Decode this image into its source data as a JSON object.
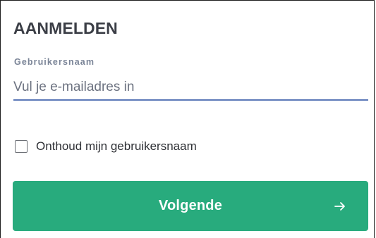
{
  "login": {
    "title": "AANMELDEN",
    "username_label": "Gebruikersnaam",
    "username_value": "",
    "username_placeholder": "Vul je e-mailadres in",
    "remember_label": "Onthoud mijn gebruikersnaam",
    "remember_checked": false,
    "next_label": "Volgende",
    "next_icon": "arrow-right-icon"
  },
  "colors": {
    "button_bg": "#28ab7d",
    "input_underline": "#5c79b8",
    "label": "#7a8497",
    "title": "#3b3e46"
  }
}
